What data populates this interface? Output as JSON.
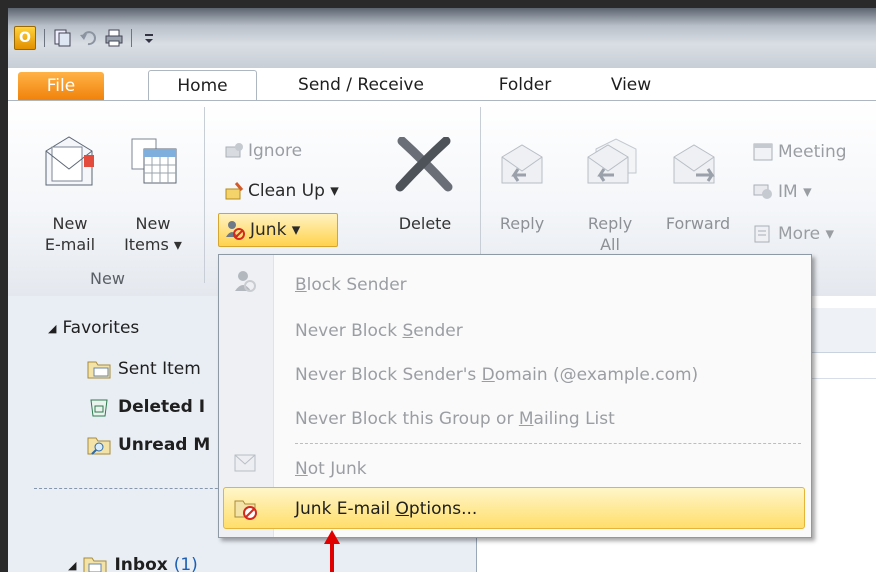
{
  "qat": {
    "app_icon": "O"
  },
  "tabs": [
    "File",
    "Home",
    "Send / Receive",
    "Folder",
    "View"
  ],
  "ribbon": {
    "new_email": {
      "line1": "New",
      "line2": "E-mail"
    },
    "new_items": {
      "line1": "New",
      "line2": "Items ▾"
    },
    "new_group_label": "New",
    "ignore": "Ignore",
    "clean_up": "Clean Up ▾",
    "junk": "Junk ▾",
    "delete": "Delete",
    "reply": "Reply",
    "reply_all": {
      "line1": "Reply",
      "line2": "All"
    },
    "forward": "Forward",
    "meeting": "Meeting",
    "im": "IM ▾",
    "more": "More ▾"
  },
  "nav": {
    "favorites": "Favorites",
    "sent_items": "Sent Item",
    "deleted_items": "Deleted I",
    "unread_mail": "Unread M",
    "inbox": "Inbox",
    "inbox_count": "(1)"
  },
  "junk_menu": {
    "block_sender": {
      "pre": "",
      "u": "B",
      "post": "lock Sender"
    },
    "never_block_sender": {
      "pre": "Never Block ",
      "u": "S",
      "post": "ender"
    },
    "never_block_domain": {
      "pre": "Never Block Sender's ",
      "u": "D",
      "post": "omain (@example.com)"
    },
    "never_block_group": {
      "pre": "Never Block this Group or ",
      "u": "M",
      "post": "ailing List"
    },
    "not_junk": {
      "pre": "",
      "u": "N",
      "post": "ot Junk"
    },
    "junk_options": {
      "pre": "Junk E-mail ",
      "u": "O",
      "post": "ptions..."
    }
  },
  "colors": {
    "accent": "#f0820b",
    "highlight": "#ffde6a",
    "arrow": "#e00000"
  }
}
